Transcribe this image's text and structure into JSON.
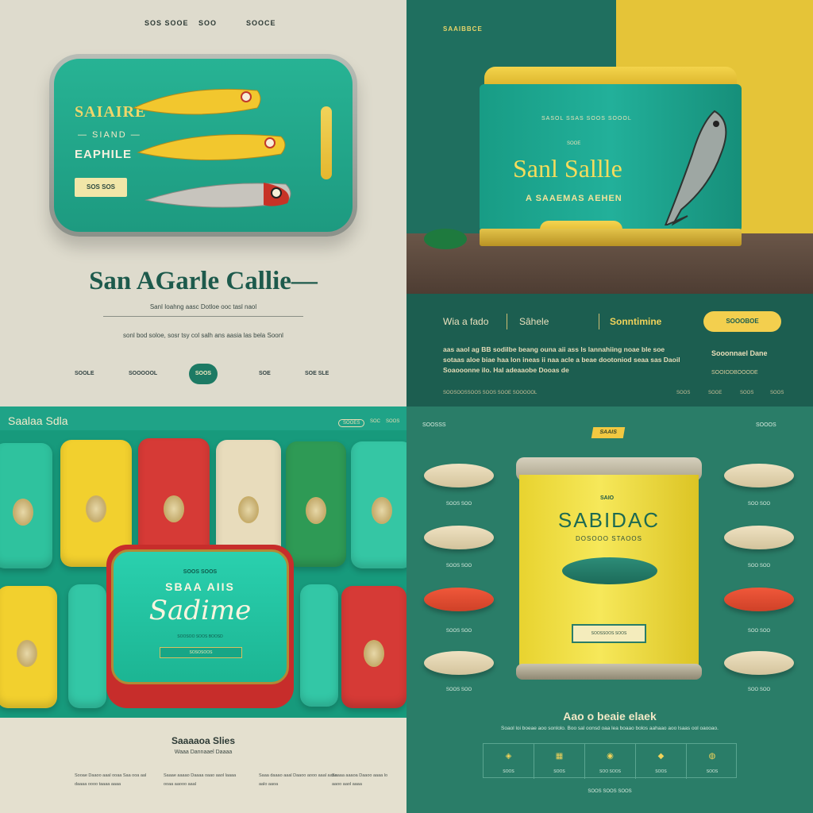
{
  "colors": {
    "teal": "#1d9a80",
    "yellow": "#e5c438",
    "red": "#c72d2b",
    "cream": "#dedbcd",
    "dark_teal": "#1c5e50"
  },
  "panel1": {
    "nav_left": "SOS SOOE",
    "nav_center": "SOO",
    "nav_right": "SOOCE",
    "tin_brand": "SAIAIRE",
    "tin_sub": "— SIAND —",
    "tin_name": "EAPHILE",
    "tin_tag": "SOS SOS",
    "title": "San AGarle Callie—",
    "tagline": "Sanl Ioahng aasc Dotloe ooc tasl naol",
    "body_line": "sonl bod soloe, sosr tsy col salh ans aasia las bela Soonl",
    "nav_items": [
      "SOOLE",
      "SOOOOOL",
      "SOOS",
      "SOE",
      "SOE SLE"
    ]
  },
  "panel2": {
    "top_label": "SAAIBBCE",
    "tin_small": "SASOL SSAS SOOS SOOOL",
    "tin_tiny": "SOOE",
    "tin_brand": "Sanl Sallle",
    "tin_sub": "A SAAEMAS AEHEN",
    "nav_1": "Wia a fado",
    "nav_2": "Sâhele",
    "nav_3": "Sonntimine",
    "button": "SOOOBOE",
    "paragraph": "aas aaol ag BB sodilbe beang ouna aii ass ls lannahiing noae ble soe sotaas aloe biae haa lon ineas ii naa acle a beae dootoniod seaa sas Daoil Soaooonne ilo. Hal adeaaobe Dooas de",
    "side_title": "Sooonnael Dane",
    "side_sub": "SOOIODBOOODE",
    "footer": [
      "SOOSOOSSOOS SOOS SOOE SOOOOOL",
      "SOOS",
      "SOOE",
      "SOOS",
      "SOOS"
    ]
  },
  "panel3": {
    "title": "Saalaa Sdla",
    "nav": [
      "SOOES",
      "SOC",
      "SOOS"
    ],
    "tin_small": "SOOS SOOS",
    "tin_mid": "SBAA AIIS",
    "tin_script": "Sadime",
    "tin_tiny": "SOOSOO SOOS BOOSD",
    "tin_ribbon": "SOSOSOOS",
    "heading": "Saaaaoa Slies",
    "sub": "Waaa Dannaael Daaaa",
    "columns": [
      "Sooae Daaoo aaal ooaa Saa ooa aal daaaa oooo taaaa aaaa",
      "Saaae aaaao Daaaa oaao aaol laaaa ooaa aaooo aaal",
      "Saaa daaao aaal Daaoo aooo aaal aaaa aalo aaoa",
      "Saaaa aaaoa Daaoo aaaa lo aaoo aaol aaaa"
    ]
  },
  "panel4": {
    "top_left": "SOOSSS",
    "badge": "SAAIS",
    "top_right": "SOOOS",
    "fish_labels": [
      "SOOS SOO",
      "SOOS SOO",
      "SOOS SOO",
      "SOOS SOO",
      "SOO SOO",
      "SOO SOO",
      "SOO SOO",
      "SOO SOO"
    ],
    "can_small": "SAIO",
    "can_brand": "SABIDAC",
    "can_sub": "DOSOOO STAOOS",
    "can_plate": "SOOSSOOS SOOS",
    "title": "Aao o beaie elaek",
    "paragraph": "Soaol loi boeae aoo sonlolo. Boo sal oonsd oaa lea boaao bolos aahaao aoo lsaas ool oaooao.",
    "icons": [
      {
        "glyph": "◈",
        "label": "SOOS"
      },
      {
        "glyph": "▦",
        "label": "SOOS"
      },
      {
        "glyph": "◉",
        "label": "SOO SOOS"
      },
      {
        "glyph": "◆",
        "label": "SOOS"
      },
      {
        "glyph": "◍",
        "label": "SOOS"
      }
    ],
    "footer": "SOOS SOOS SOOS"
  }
}
